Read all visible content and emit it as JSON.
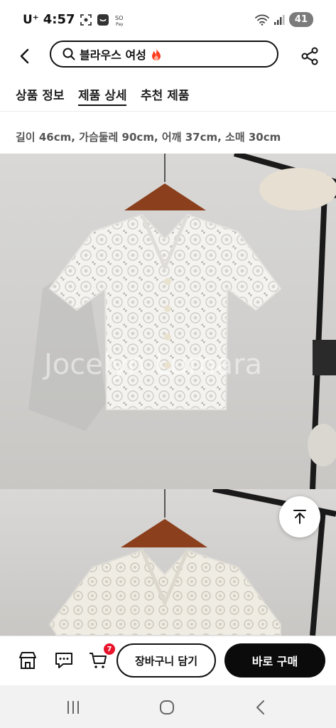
{
  "status": {
    "carrier": "U⁺",
    "time": "4:57",
    "battery": "41"
  },
  "header": {
    "search_text": "블라우스 여성",
    "icons": {
      "back": "back-arrow-icon",
      "search": "search-icon",
      "fire": "fire-icon",
      "share": "share-icon"
    }
  },
  "tabs": [
    {
      "label": "상품 정보",
      "active": false
    },
    {
      "label": "제품 상세",
      "active": true
    },
    {
      "label": "추천 제품",
      "active": false
    }
  ],
  "detail": {
    "size_info": "길이 46cm, 가슴둘레 90cm, 어깨 37cm, 소매 30cm",
    "watermark": "Jocelyn Lumara"
  },
  "bottom_bar": {
    "cart_badge": "7",
    "add_to_cart": "장바구니 담기",
    "buy_now": "바로 구매",
    "icons": [
      "store-icon",
      "chat-icon",
      "cart-icon"
    ]
  },
  "colors": {
    "accent_red": "#e8142b",
    "fire": "#ff3b1f",
    "button_dark": "#0b0b0b"
  }
}
